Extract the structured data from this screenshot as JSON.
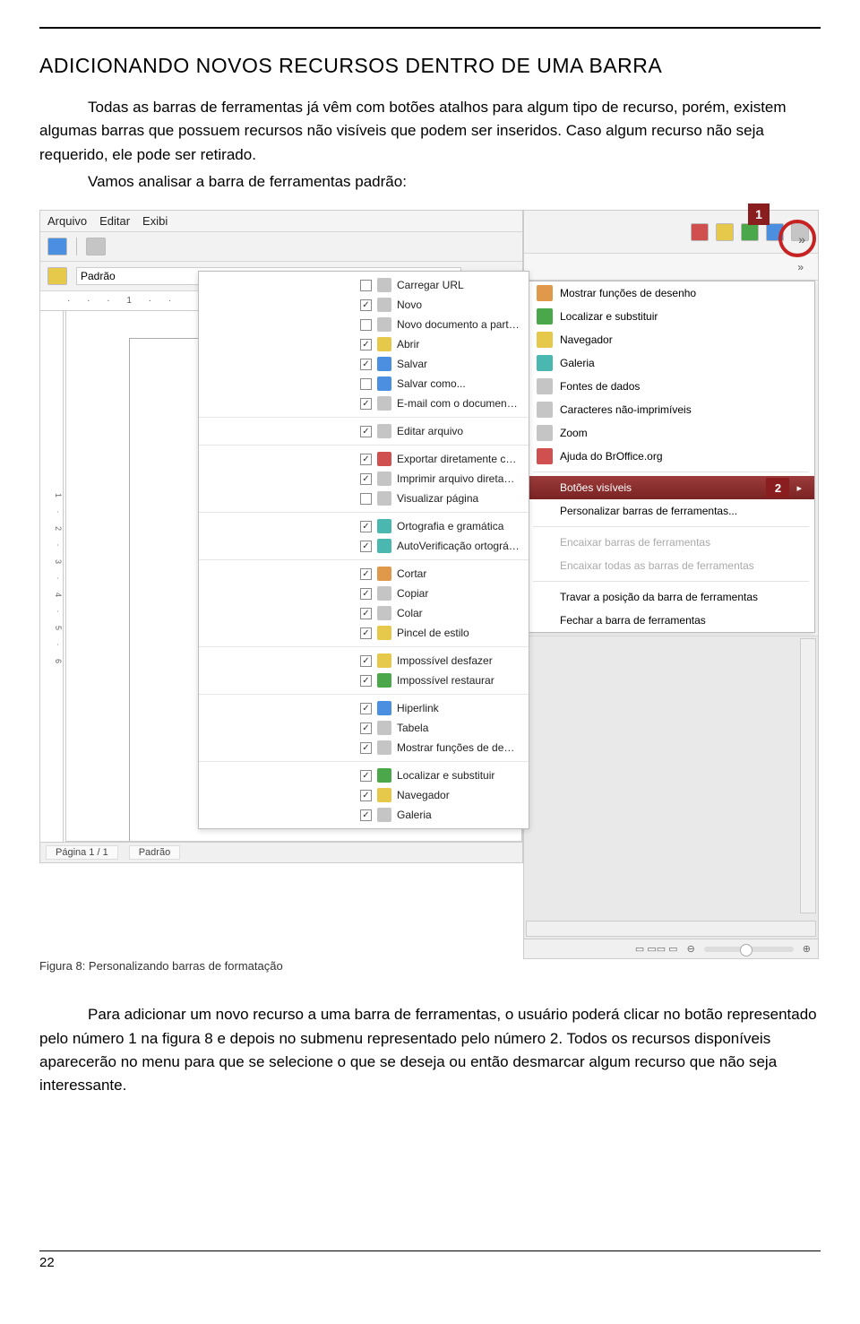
{
  "heading": "ADICIONANDO NOVOS RECURSOS DENTRO DE UMA BARRA",
  "para1": "Todas as barras de ferramentas já vêm com botões atalhos para algum tipo de recurso, porém, existem algumas barras que possuem recursos não visíveis que podem ser inseridos. Caso algum recurso não seja requerido, ele pode ser retirado.",
  "para2": "Vamos analisar a barra de ferramentas padrão:",
  "figcaption": "Figura 8: Personalizando barras de formatação",
  "para3": "Para adicionar um novo recurso a uma barra de ferramentas, o usuário poderá clicar no botão representado pelo número 1 na figura 8 e depois no submenu representado pelo número 2. Todos os recursos disponíveis aparecerão no menu para que se selecione o que se deseja ou então desmarcar algum recurso que não seja interessante.",
  "pagenum": "22",
  "left": {
    "menubar": [
      "Arquivo",
      "Editar",
      "Exibi"
    ],
    "style_box": "Padrão",
    "ruler": "· · · 1 · ·",
    "vruler": "1 · 2 · 3 · 4 · 5 · 6",
    "status_page": "Página 1 / 1",
    "status_style": "Padrão",
    "groups": [
      [
        {
          "ck": false,
          "icon": "c-grey",
          "label": "Carregar URL"
        },
        {
          "ck": true,
          "icon": "c-grey",
          "label": "Novo"
        },
        {
          "ck": false,
          "icon": "c-grey",
          "label": "Novo documento a partir de um modelo"
        },
        {
          "ck": true,
          "icon": "c-yellow",
          "label": "Abrir"
        },
        {
          "ck": true,
          "icon": "c-blue",
          "label": "Salvar"
        },
        {
          "ck": false,
          "icon": "c-blue",
          "label": "Salvar como..."
        },
        {
          "ck": true,
          "icon": "c-grey",
          "label": "E-mail com o documento anexado"
        }
      ],
      [
        {
          "ck": true,
          "icon": "c-grey",
          "label": "Editar arquivo"
        }
      ],
      [
        {
          "ck": true,
          "icon": "c-red",
          "label": "Exportar diretamente como PDF"
        },
        {
          "ck": true,
          "icon": "c-grey",
          "label": "Imprimir arquivo diretamente (DIOPE-PIPO)"
        },
        {
          "ck": false,
          "icon": "c-grey",
          "label": "Visualizar página"
        }
      ],
      [
        {
          "ck": true,
          "icon": "c-teal",
          "label": "Ortografia e gramática"
        },
        {
          "ck": true,
          "icon": "c-teal",
          "label": "AutoVerificação ortográfica"
        }
      ],
      [
        {
          "ck": true,
          "icon": "c-orange",
          "label": "Cortar"
        },
        {
          "ck": true,
          "icon": "c-grey",
          "label": "Copiar"
        },
        {
          "ck": true,
          "icon": "c-grey",
          "label": "Colar"
        },
        {
          "ck": true,
          "icon": "c-yellow",
          "label": "Pincel de estilo"
        }
      ],
      [
        {
          "ck": true,
          "icon": "c-yellow",
          "label": "Impossível desfazer"
        },
        {
          "ck": true,
          "icon": "c-green",
          "label": "Impossível restaurar"
        }
      ],
      [
        {
          "ck": true,
          "icon": "c-blue",
          "label": "Hiperlink"
        },
        {
          "ck": true,
          "icon": "c-grey",
          "label": "Tabela"
        },
        {
          "ck": true,
          "icon": "c-grey",
          "label": "Mostrar funções de desenho"
        }
      ],
      [
        {
          "ck": true,
          "icon": "c-green",
          "label": "Localizar e substituir"
        },
        {
          "ck": true,
          "icon": "c-yellow",
          "label": "Navegador"
        },
        {
          "ck": true,
          "icon": "c-grey",
          "label": "Galeria"
        }
      ]
    ]
  },
  "right": {
    "badge1": "1",
    "badge2": "2",
    "expand": "»",
    "menu_top": [
      {
        "icon": "c-orange",
        "label": "Mostrar funções de desenho"
      },
      {
        "icon": "c-green",
        "label": "Localizar e substituir"
      },
      {
        "icon": "c-yellow",
        "label": "Navegador"
      },
      {
        "icon": "c-teal",
        "label": "Galeria"
      },
      {
        "icon": "c-grey",
        "label": "Fontes de dados"
      },
      {
        "icon": "c-grey",
        "label": "Caracteres não-imprimíveis"
      },
      {
        "icon": "c-grey",
        "label": "Zoom"
      },
      {
        "icon": "c-red",
        "label": "Ajuda do BrOffice.org"
      }
    ],
    "menu_mid_selected": "Botões visíveis",
    "menu_mid": [
      "Personalizar barras de ferramentas..."
    ],
    "menu_dis": [
      "Encaixar barras de ferramentas",
      "Encaixar todas as barras de ferramentas"
    ],
    "menu_bot": [
      "Travar a posição da barra de ferramentas",
      "Fechar a barra de ferramentas"
    ]
  }
}
